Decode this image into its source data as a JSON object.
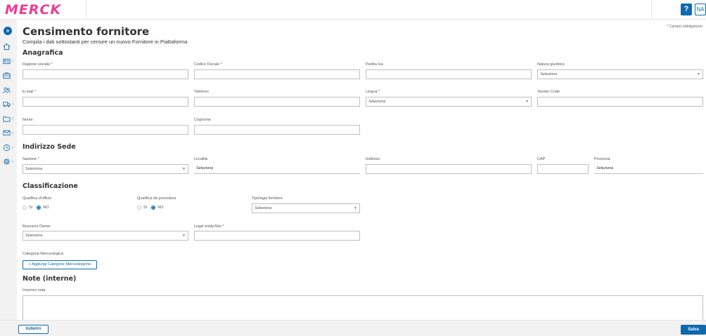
{
  "header": {
    "logo_text": "MERCK",
    "help_label": "?",
    "user_initials": "NA"
  },
  "sidebar": {
    "toggle_glyph": "»",
    "items": [
      {
        "name": "home-icon",
        "has_chevron": false
      },
      {
        "name": "id-card-icon",
        "has_chevron": true
      },
      {
        "name": "briefcase-icon",
        "has_chevron": false
      },
      {
        "name": "users-icon",
        "has_chevron": false
      },
      {
        "name": "truck-icon",
        "has_chevron": true
      },
      {
        "name": "folder-icon",
        "has_chevron": true
      },
      {
        "name": "mail-icon",
        "has_chevron": true
      },
      {
        "name": "clock-icon",
        "has_chevron": true
      },
      {
        "name": "gear-icon",
        "has_chevron": true
      }
    ],
    "chevron": "›"
  },
  "page": {
    "title": "Censimento fornitore",
    "subtitle": "Compila i dati sottostanti per censire un nuovo Fornitore in Piattaforma",
    "required_note": "* Campo obbligatorio"
  },
  "sections": {
    "anagrafica": "Anagrafica",
    "indirizzo": "Indirizzo Sede",
    "classificazione": "Classificazione",
    "note": "Note (interne)"
  },
  "fields": {
    "ragione_sociale": {
      "label": "Ragione sociale *",
      "value": ""
    },
    "codice_fiscale": {
      "label": "Codice Fiscale *",
      "value": ""
    },
    "partita_iva": {
      "label": "Partita Iva",
      "value": ""
    },
    "natura_giuridica": {
      "label": "Natura giuridica",
      "value": "Seleziona"
    },
    "email": {
      "label": "E-mail *",
      "value": ""
    },
    "telefono": {
      "label": "Telefono",
      "value": ""
    },
    "lingua": {
      "label": "Lingua *",
      "value": "Seleziona"
    },
    "vendor_code": {
      "label": "Vendor Code",
      "value": ""
    },
    "nome": {
      "label": "Nome",
      "value": ""
    },
    "cognome": {
      "label": "Cognome",
      "value": ""
    },
    "nazione": {
      "label": "Nazione *",
      "value": "Seleziona"
    },
    "localita": {
      "label": "Località",
      "value": "Seleziona"
    },
    "indirizzo": {
      "label": "Indirizzo",
      "value": ""
    },
    "cap": {
      "label": "CAP",
      "value": ""
    },
    "provincia": {
      "label": "Provincia",
      "value": "Seleziona"
    },
    "qualifica_ufficio": {
      "label": "Qualifica d'ufficio",
      "opt_si": "SI",
      "opt_no": "NO",
      "selected": "NO"
    },
    "qualifica_procedura": {
      "label": "Qualifica da procedura",
      "opt_si": "SI",
      "opt_no": "NO",
      "selected": "NO"
    },
    "tipologia_fornitore": {
      "label": "Tipologia fornitore",
      "value": "Seleziona"
    },
    "business_owner": {
      "label": "Business Owner",
      "value": "Seleziona"
    },
    "legal_entity": {
      "label": "Legal entity/Sito *",
      "value": ""
    },
    "categoria_merceologica": {
      "label": "Categoria Merceologica",
      "button": "+ Aggiungi Categorie Merceologiche"
    },
    "note": {
      "label": "Inserisci nota",
      "value": ""
    }
  },
  "footer": {
    "back_label": "Indietro",
    "save_label": "Salva"
  },
  "colors": {
    "brand_pink": "#eb3c96",
    "primary_blue": "#0f69af"
  }
}
